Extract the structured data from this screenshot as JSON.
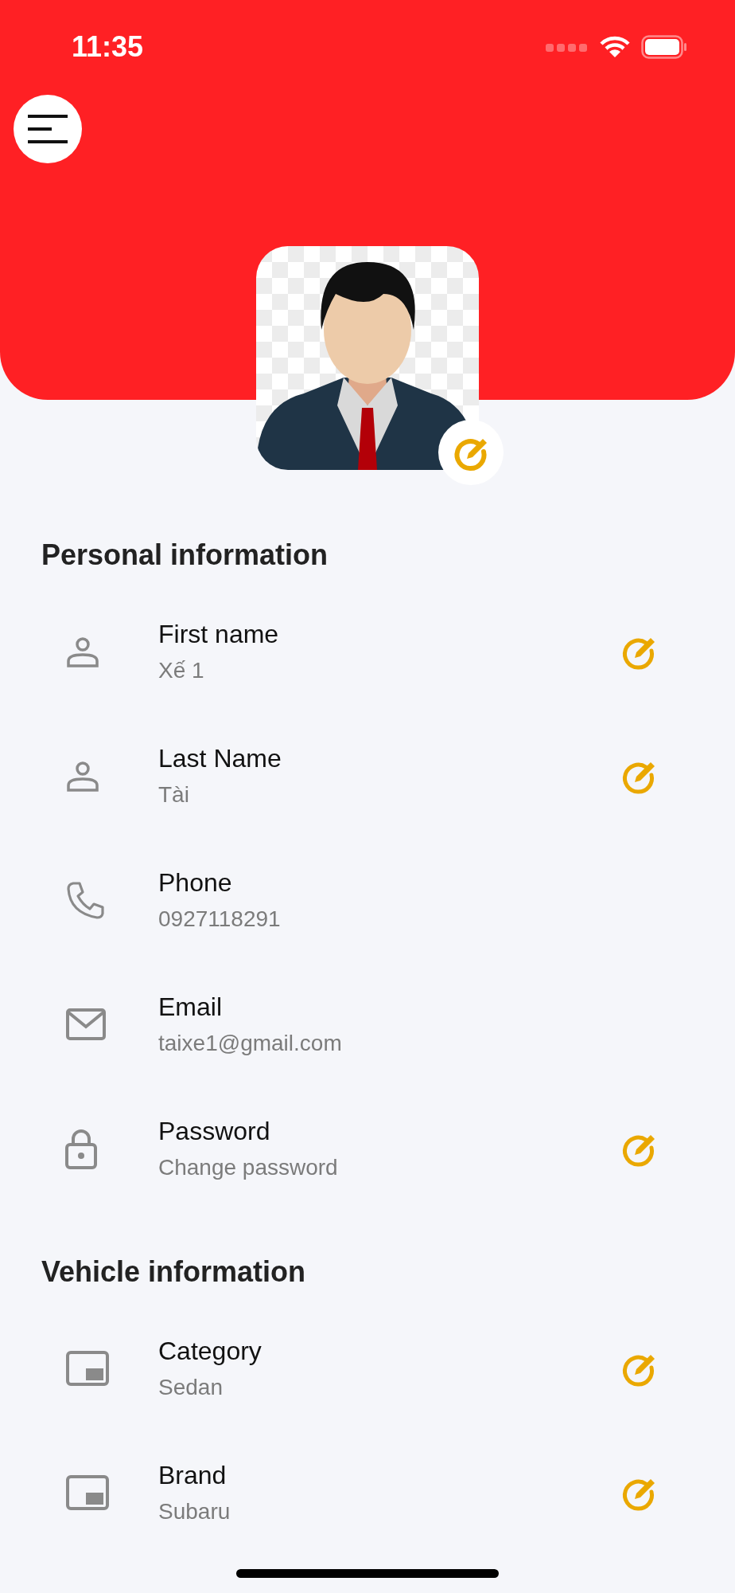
{
  "status_bar": {
    "time": "11:35"
  },
  "sections": [
    {
      "title": "Personal information",
      "items": [
        {
          "kind": "person",
          "label": "First name",
          "value": "Xế 1",
          "editable": true
        },
        {
          "kind": "person",
          "label": "Last Name",
          "value": "Tài",
          "editable": true
        },
        {
          "kind": "phone",
          "label": "Phone",
          "value": "0927118291",
          "editable": false
        },
        {
          "kind": "mail",
          "label": "Email",
          "value": "taixe1@gmail.com",
          "editable": false
        },
        {
          "kind": "lock",
          "label": "Password",
          "value": "Change password",
          "editable": true
        }
      ]
    },
    {
      "title": "Vehicle information",
      "items": [
        {
          "kind": "card",
          "label": "Category",
          "value": "Sedan",
          "editable": true
        },
        {
          "kind": "card",
          "label": "Brand",
          "value": "Subaru",
          "editable": true
        }
      ]
    }
  ]
}
